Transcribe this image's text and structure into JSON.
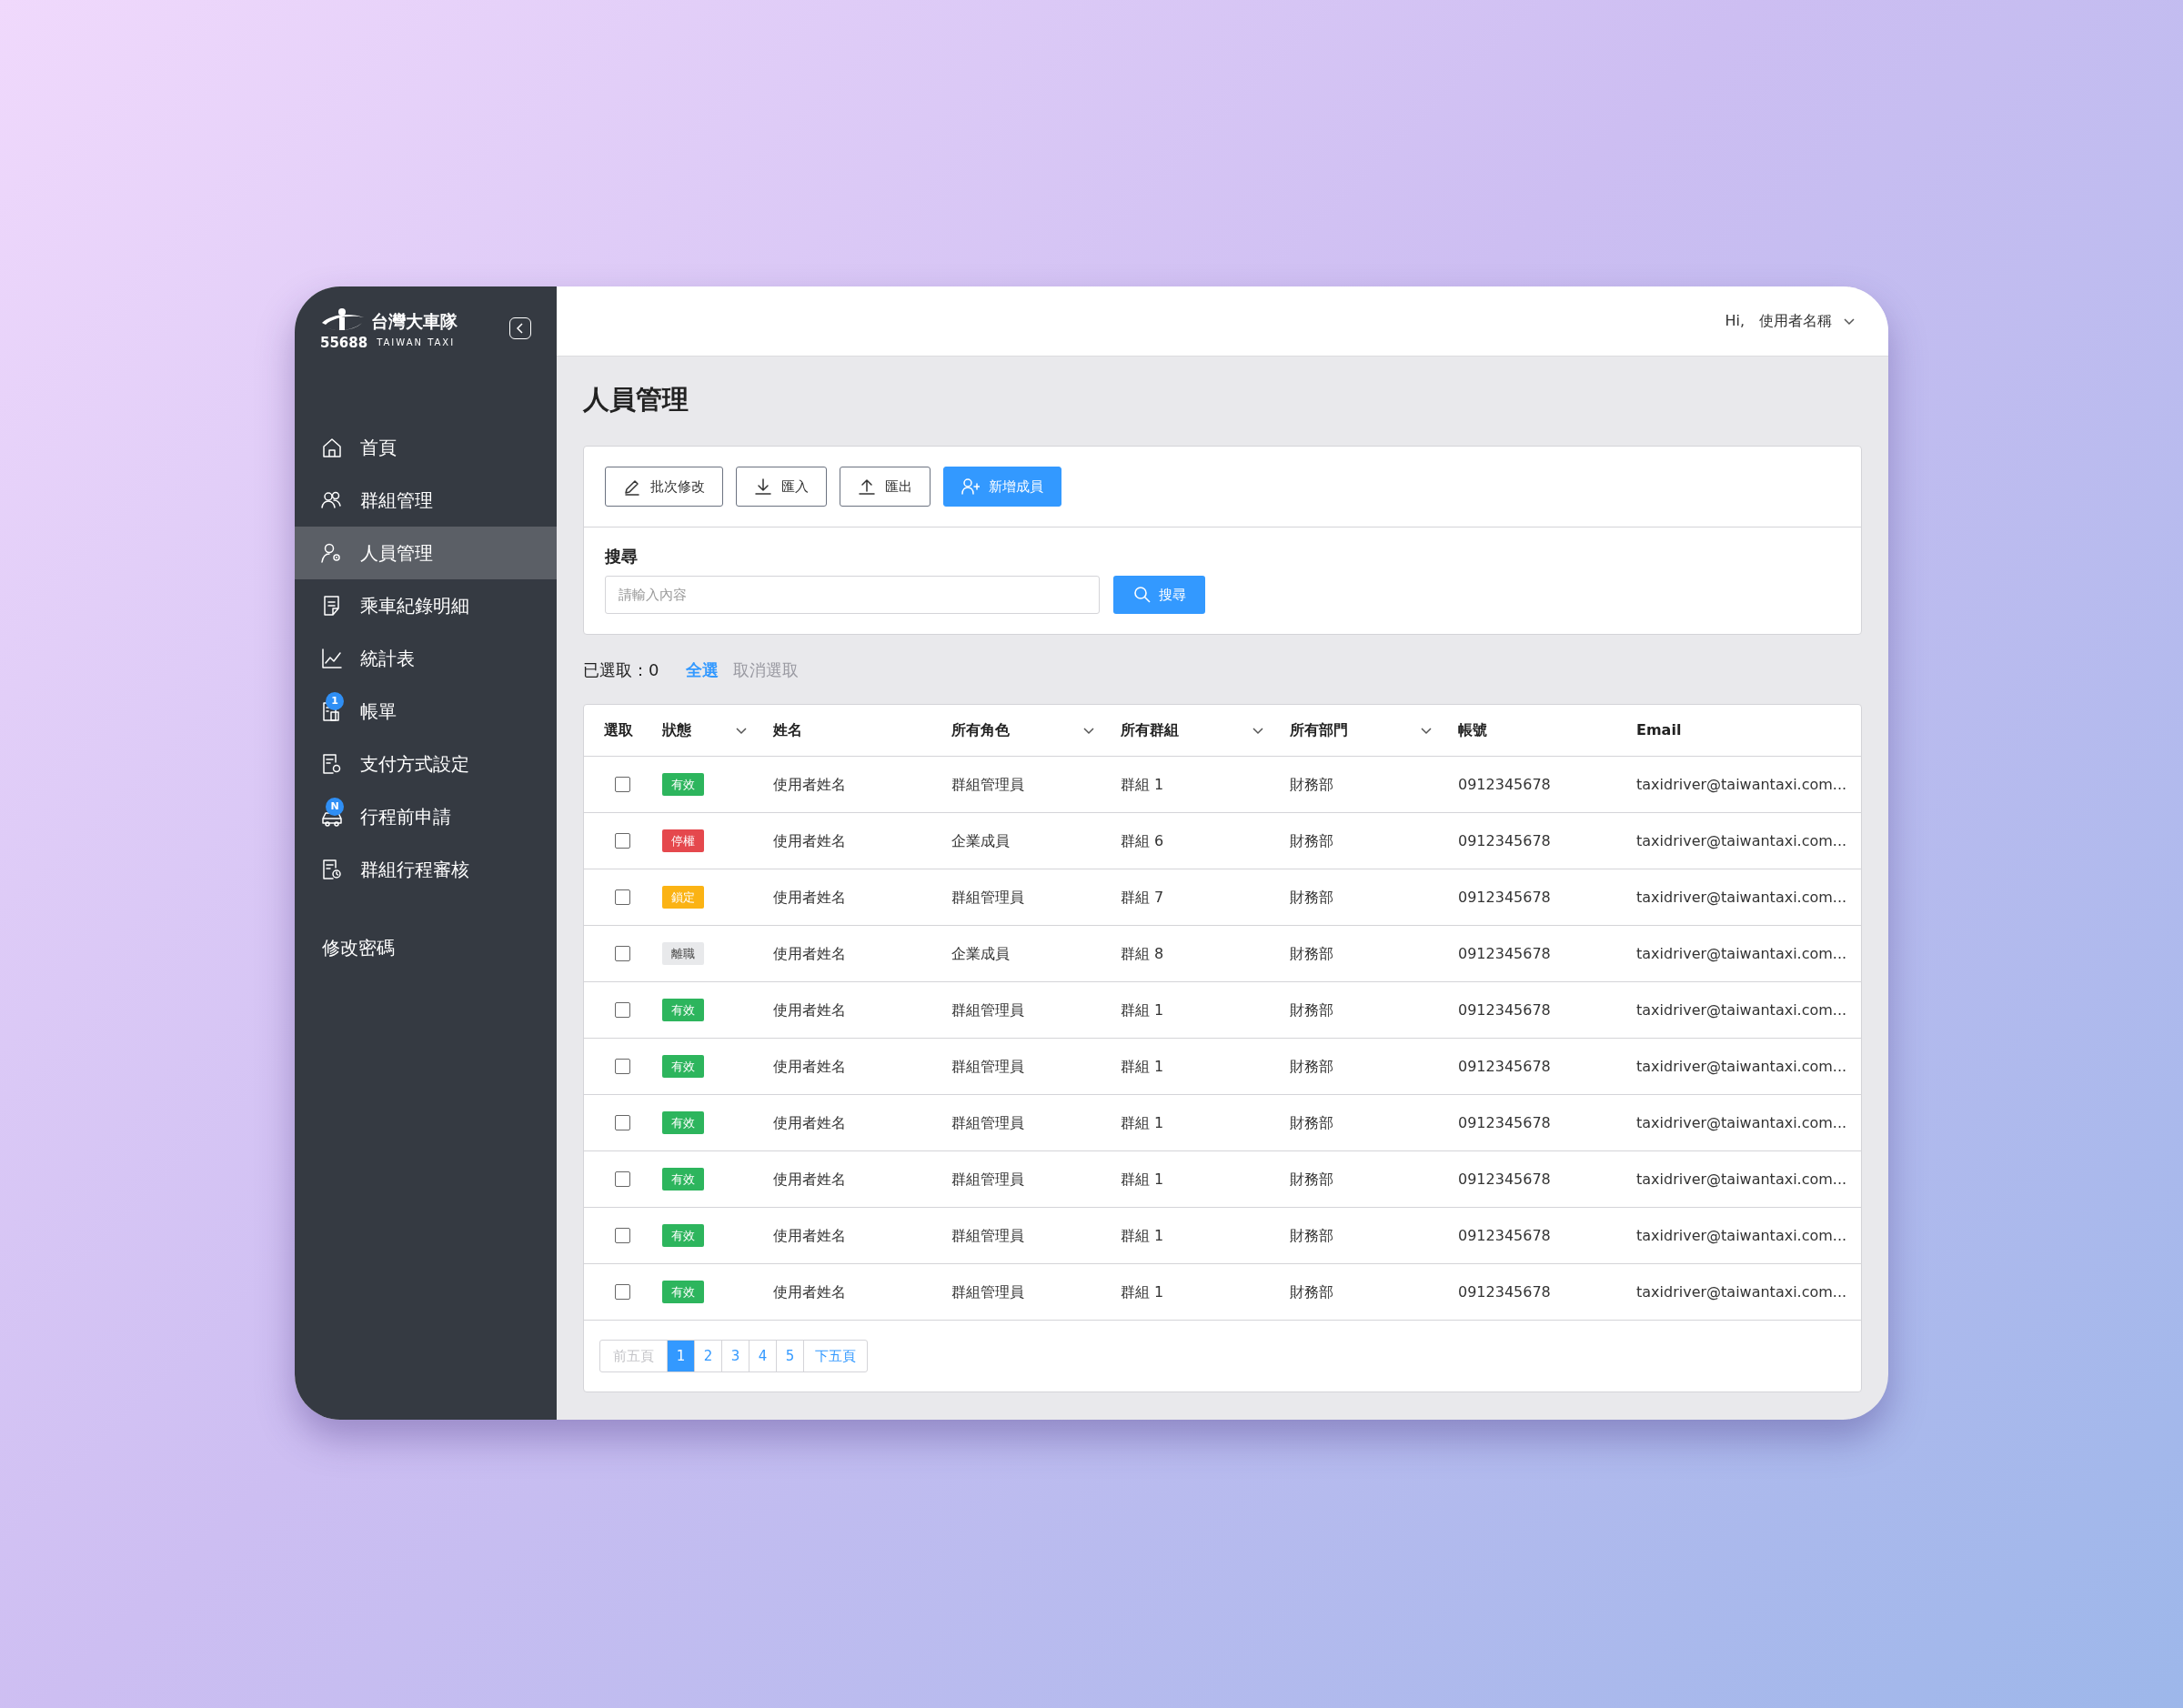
{
  "logo": {
    "name": "台灣大車隊",
    "number": "55688",
    "english": "TAIWAN TAXI"
  },
  "sidebar": {
    "items": [
      {
        "label": "首頁",
        "selected": false
      },
      {
        "label": "群組管理",
        "selected": false
      },
      {
        "label": "人員管理",
        "selected": true
      },
      {
        "label": "乘車紀錄明細",
        "selected": false
      },
      {
        "label": "統計表",
        "selected": false
      },
      {
        "label": "帳單",
        "selected": false,
        "badge": "1"
      },
      {
        "label": "支付方式設定",
        "selected": false
      },
      {
        "label": "行程前申請",
        "selected": false,
        "badge": "N"
      },
      {
        "label": "群組行程審核",
        "selected": false
      }
    ],
    "footer_link": "修改密碼"
  },
  "header": {
    "greeting": "Hi,",
    "user": "使用者名稱"
  },
  "page_title": "人員管理",
  "toolbar": {
    "buttons": [
      {
        "label": "批次修改",
        "kind": "outline"
      },
      {
        "label": "匯入",
        "kind": "outline"
      },
      {
        "label": "匯出",
        "kind": "outline"
      },
      {
        "label": "新增成員",
        "kind": "primary"
      }
    ]
  },
  "search": {
    "label": "搜尋",
    "placeholder": "請輸入內容",
    "button": "搜尋"
  },
  "selection": {
    "label": "已選取：0",
    "select_all": "全選",
    "clear": "取消選取",
    "clear_disabled": true
  },
  "table": {
    "columns": [
      {
        "label": "選取",
        "dropdown": false
      },
      {
        "label": "狀態",
        "dropdown": true
      },
      {
        "label": "姓名",
        "dropdown": false
      },
      {
        "label": "所有角色",
        "dropdown": true
      },
      {
        "label": "所有群組",
        "dropdown": true
      },
      {
        "label": "所有部門",
        "dropdown": true
      },
      {
        "label": "帳號",
        "dropdown": false
      },
      {
        "label": "Email",
        "dropdown": false
      }
    ],
    "rows": [
      {
        "checked": false,
        "status": "有效",
        "color": "#2db55d",
        "name": "使用者姓名",
        "role": "群組管理員",
        "group": "群組 1",
        "department": "財務部",
        "account": "0912345678",
        "email": "taxidriver@taiwantaxi.com..."
      },
      {
        "checked": false,
        "status": "停權",
        "color": "#e5484d",
        "name": "使用者姓名",
        "role": "企業成員",
        "group": "群組 6",
        "department": "財務部",
        "account": "0912345678",
        "email": "taxidriver@taiwantaxi.com..."
      },
      {
        "checked": false,
        "status": "鎖定",
        "color": "#fbb314",
        "name": "使用者姓名",
        "role": "群組管理員",
        "group": "群組 7",
        "department": "財務部",
        "account": "0912345678",
        "email": "taxidriver@taiwantaxi.com..."
      },
      {
        "checked": false,
        "status": "離職",
        "color": "#e8e9eb",
        "name": "使用者姓名",
        "role": "企業成員",
        "group": "群組 8",
        "department": "財務部",
        "account": "0912345678",
        "email": "taxidriver@taiwantaxi.com..."
      },
      {
        "checked": false,
        "status": "有效",
        "color": "#2db55d",
        "name": "使用者姓名",
        "role": "群組管理員",
        "group": "群組 1",
        "department": "財務部",
        "account": "0912345678",
        "email": "taxidriver@taiwantaxi.com..."
      },
      {
        "checked": false,
        "status": "有效",
        "color": "#2db55d",
        "name": "使用者姓名",
        "role": "群組管理員",
        "group": "群組 1",
        "department": "財務部",
        "account": "0912345678",
        "email": "taxidriver@taiwantaxi.com..."
      },
      {
        "checked": false,
        "status": "有效",
        "color": "#2db55d",
        "name": "使用者姓名",
        "role": "群組管理員",
        "group": "群組 1",
        "department": "財務部",
        "account": "0912345678",
        "email": "taxidriver@taiwantaxi.com..."
      },
      {
        "checked": false,
        "status": "有效",
        "color": "#2db55d",
        "name": "使用者姓名",
        "role": "群組管理員",
        "group": "群組 1",
        "department": "財務部",
        "account": "0912345678",
        "email": "taxidriver@taiwantaxi.com..."
      },
      {
        "checked": false,
        "status": "有效",
        "color": "#2db55d",
        "name": "使用者姓名",
        "role": "群組管理員",
        "group": "群組 1",
        "department": "財務部",
        "account": "0912345678",
        "email": "taxidriver@taiwantaxi.com..."
      },
      {
        "checked": false,
        "status": "有效",
        "color": "#2db55d",
        "name": "使用者姓名",
        "role": "群組管理員",
        "group": "群組 1",
        "department": "財務部",
        "account": "0912345678",
        "email": "taxidriver@taiwantaxi.com..."
      }
    ]
  },
  "pagination": {
    "previous": "前五頁",
    "previous_disabled": true,
    "pages": [
      {
        "label": "1",
        "selected": true
      },
      {
        "label": "2",
        "selected": false
      },
      {
        "label": "3",
        "selected": false
      },
      {
        "label": "4",
        "selected": false
      },
      {
        "label": "5",
        "selected": false
      }
    ],
    "next": "下五頁"
  }
}
